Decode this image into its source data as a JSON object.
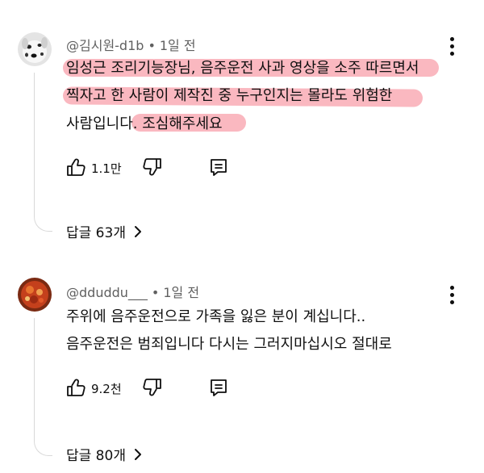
{
  "comments": [
    {
      "author": "@김시원-d1b",
      "time": "1일 전",
      "lines": [
        "임성근 조리기능장님, 음주운전 사과 영상을 소주 따르면서",
        "찍자고 한 사람이 제작진 중 누구인지는 몰라도 위험한",
        "사람입니다. 조심해주세요"
      ],
      "likes": "1.1만",
      "replies_label": "답글 63개",
      "highlight_color": "#f67e8c"
    },
    {
      "author": "@dduddu___",
      "time": "1일 전",
      "lines": [
        "주위에 음주운전으로 가족을 잃은 분이 계십니다..",
        "음주운전은 범죄입니다 다시는 그러지마십시오 절대로"
      ],
      "likes": "9.2천",
      "replies_label": "답글 80개"
    }
  ],
  "icons": {
    "like": "thumbs-up-icon",
    "dislike": "thumbs-down-icon",
    "reply": "comment-reply-icon",
    "more": "more-vert-icon",
    "chevron": "chevron-right-icon"
  }
}
